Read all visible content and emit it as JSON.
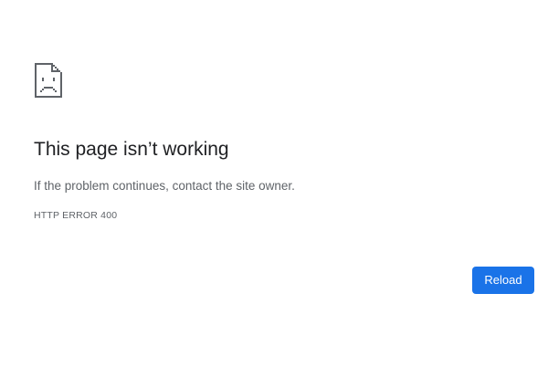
{
  "error": {
    "icon": "sad-page-icon",
    "title": "This page isn’t working",
    "message": "If the problem continues, contact the site owner.",
    "code": "HTTP ERROR 400"
  },
  "actions": {
    "reload_label": "Reload"
  },
  "colors": {
    "title": "#202124",
    "body_text": "#5f6368",
    "button_bg": "#1a73e8",
    "button_text": "#ffffff",
    "icon": "#5f6368"
  }
}
